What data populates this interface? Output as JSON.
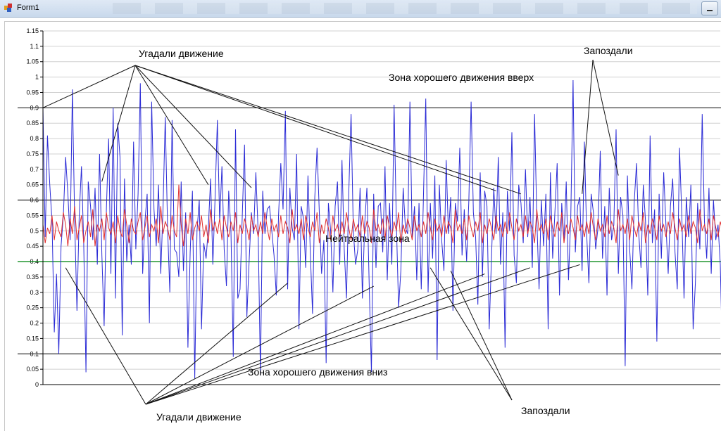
{
  "window": {
    "title": "Form1"
  },
  "colors": {
    "series_blue": "#2b2bd6",
    "series_red": "#e03030",
    "green_line": "#0a8a1a",
    "ref_line": "#3a3a3a",
    "grid": "#d0d0d0"
  },
  "chart_data": {
    "type": "line",
    "title": "",
    "xlabel": "",
    "ylabel": "",
    "ylim": [
      0,
      1.15
    ],
    "y_ticks": [
      "1.15",
      "1.1",
      "1.05",
      "1",
      "0.95",
      "0.9",
      "0.85",
      "0.8",
      "0.75",
      "0.7",
      "0.65",
      "0.6",
      "0.55",
      "0.5",
      "0.45",
      "0.4",
      "0.35",
      "0.3",
      "0.25",
      "0.2",
      "0.15",
      "0.1",
      "0.05",
      "0"
    ],
    "x_ticks_visible": false,
    "grid": true,
    "legend": "none",
    "x_count": 300,
    "series": [
      {
        "color": "#2b2bd6",
        "values": [
          0.9,
          0.48,
          0.81,
          0.65,
          0.53,
          0.17,
          0.36,
          0.1,
          0.45,
          0.55,
          0.74,
          0.62,
          0.47,
          0.96,
          0.54,
          0.24,
          0.55,
          0.71,
          0.46,
          0.04,
          0.66,
          0.58,
          0.47,
          0.64,
          0.39,
          0.75,
          0.42,
          0.19,
          0.57,
          0.8,
          0.36,
          0.9,
          0.28,
          0.85,
          0.74,
          0.16,
          0.67,
          0.4,
          0.52,
          0.39,
          0.79,
          0.44,
          0.62,
          0.98,
          0.36,
          0.53,
          0.62,
          0.2,
          0.92,
          0.57,
          0.45,
          0.65,
          0.36,
          0.57,
          0.87,
          0.51,
          0.3,
          0.86,
          0.44,
          0.43,
          0.35,
          0.66,
          0.37,
          0.56,
          0.12,
          0.43,
          0.63,
          0.02,
          0.5,
          0.6,
          0.18,
          0.46,
          0.41,
          0.51,
          0.67,
          0.39,
          0.61,
          0.86,
          0.53,
          0.71,
          0.44,
          0.32,
          0.63,
          0.5,
          0.09,
          0.83,
          0.28,
          0.31,
          0.55,
          0.78,
          0.22,
          0.4,
          0.56,
          0.49,
          0.69,
          0.49,
          0.03,
          0.63,
          0.49,
          0.57,
          0.58,
          0.5,
          0.42,
          0.29,
          0.55,
          0.72,
          0.57,
          0.89,
          0.31,
          0.64,
          0.51,
          0.47,
          0.75,
          0.18,
          0.58,
          0.54,
          0.38,
          0.68,
          0.43,
          0.23,
          0.61,
          0.77,
          0.56,
          0.36,
          0.47,
          0.07,
          0.59,
          0.5,
          0.3,
          0.58,
          0.66,
          0.39,
          0.73,
          0.44,
          0.28,
          0.62,
          0.88,
          0.5,
          0.39,
          0.44,
          0.64,
          0.28,
          0.52,
          0.64,
          0.33,
          0.04,
          0.62,
          0.38,
          0.58,
          0.59,
          0.43,
          0.71,
          0.34,
          0.59,
          0.39,
          0.91,
          0.53,
          0.25,
          0.37,
          0.64,
          0.51,
          0.49,
          0.92,
          0.48,
          0.58,
          0.34,
          0.59,
          0.31,
          0.62,
          0.93,
          0.3,
          0.59,
          0.41,
          0.68,
          0.08,
          0.65,
          0.47,
          0.37,
          0.73,
          0.49,
          0.61,
          0.24,
          0.59,
          0.53,
          0.77,
          0.42,
          0.57,
          0.4,
          0.6,
          0.92,
          0.56,
          0.48,
          0.26,
          0.69,
          0.35,
          0.63,
          0.58,
          0.18,
          0.41,
          0.64,
          0.49,
          0.74,
          0.39,
          0.56,
          0.12,
          0.63,
          0.5,
          0.82,
          0.42,
          0.33,
          0.65,
          0.59,
          0.46,
          0.7,
          0.48,
          0.61,
          0.38,
          0.88,
          0.54,
          0.31,
          0.6,
          0.45,
          0.62,
          0.18,
          0.69,
          0.41,
          0.56,
          0.72,
          0.29,
          0.59,
          0.47,
          0.66,
          0.34,
          0.55,
          0.99,
          0.43,
          0.58,
          0.61,
          0.37,
          0.79,
          0.49,
          0.33,
          0.62,
          0.56,
          0.44,
          0.51,
          0.76,
          0.41,
          0.58,
          0.29,
          0.64,
          0.47,
          0.52,
          0.83,
          0.36,
          0.61,
          0.55,
          0.06,
          0.68,
          0.44,
          0.31,
          0.59,
          0.72,
          0.49,
          0.38,
          0.65,
          0.53,
          0.29,
          0.81,
          0.46,
          0.57,
          0.14,
          0.62,
          0.41,
          0.69,
          0.52,
          0.36,
          0.58,
          0.67,
          0.43,
          0.31,
          0.77,
          0.55,
          0.28,
          0.61,
          0.48,
          0.65,
          0.18,
          0.33,
          0.59,
          0.44,
          0.88,
          0.53,
          0.41,
          0.64,
          0.36,
          0.6,
          0.47,
          0.52,
          0.39,
          0.07,
          0.58,
          0.1,
          0.45
        ]
      },
      {
        "color": "#e03030",
        "values": [
          0.52,
          0.46,
          0.51,
          0.49,
          0.55,
          0.47,
          0.53,
          0.5,
          0.48,
          0.56,
          0.52,
          0.45,
          0.54,
          0.49,
          0.58,
          0.47,
          0.51,
          0.55,
          0.46,
          0.5,
          0.53,
          0.48,
          0.57,
          0.45,
          0.52,
          0.5,
          0.54,
          0.47,
          0.56,
          0.51,
          0.49,
          0.53,
          0.46,
          0.55,
          0.5,
          0.48,
          0.57,
          0.52,
          0.46,
          0.54,
          0.5,
          0.49,
          0.53,
          0.56,
          0.47,
          0.51,
          0.55,
          0.48,
          0.52,
          0.5,
          0.54,
          0.46,
          0.58,
          0.49,
          0.53,
          0.51,
          0.47,
          0.55,
          0.5,
          0.48,
          0.65,
          0.52,
          0.45,
          0.54,
          0.49,
          0.56,
          0.47,
          0.51,
          0.53,
          0.5,
          0.55,
          0.48,
          0.52,
          0.46,
          0.57,
          0.5,
          0.53,
          0.49,
          0.54,
          0.47,
          0.55,
          0.51,
          0.48,
          0.53,
          0.5,
          0.56,
          0.46,
          0.52,
          0.49,
          0.54,
          0.51,
          0.47,
          0.55,
          0.5,
          0.52,
          0.48,
          0.53,
          0.49,
          0.56,
          0.51,
          0.47,
          0.54,
          0.5,
          0.52,
          0.48,
          0.55,
          0.49,
          0.53,
          0.51,
          0.46,
          0.57,
          0.5,
          0.52,
          0.49,
          0.54,
          0.47,
          0.55,
          0.51,
          0.48,
          0.53,
          0.5,
          0.56,
          0.46,
          0.52,
          0.49,
          0.54,
          0.51,
          0.47,
          0.55,
          0.5,
          0.52,
          0.48,
          0.53,
          0.49,
          0.56,
          0.51,
          0.47,
          0.54,
          0.5,
          0.52,
          0.48,
          0.55,
          0.49,
          0.53,
          0.51,
          0.46,
          0.57,
          0.5,
          0.52,
          0.49,
          0.54,
          0.47,
          0.55,
          0.51,
          0.48,
          0.53,
          0.5,
          0.56,
          0.46,
          0.52,
          0.49,
          0.54,
          0.51,
          0.47,
          0.55,
          0.5,
          0.52,
          0.48,
          0.53,
          0.49,
          0.56,
          0.51,
          0.47,
          0.54,
          0.5,
          0.52,
          0.48,
          0.55,
          0.49,
          0.53,
          0.51,
          0.46,
          0.57,
          0.5,
          0.52,
          0.49,
          0.54,
          0.47,
          0.55,
          0.51,
          0.48,
          0.53,
          0.5,
          0.56,
          0.46,
          0.52,
          0.49,
          0.54,
          0.51,
          0.47,
          0.55,
          0.5,
          0.52,
          0.48,
          0.53,
          0.49,
          0.56,
          0.51,
          0.47,
          0.54,
          0.5,
          0.52,
          0.48,
          0.55,
          0.49,
          0.53,
          0.51,
          0.46,
          0.57,
          0.5,
          0.52,
          0.49,
          0.54,
          0.47,
          0.55,
          0.51,
          0.48,
          0.53,
          0.5,
          0.56,
          0.46,
          0.52,
          0.49,
          0.54,
          0.51,
          0.47,
          0.55,
          0.5,
          0.52,
          0.48,
          0.53,
          0.49,
          0.56,
          0.51,
          0.47,
          0.54,
          0.5,
          0.52,
          0.48,
          0.55,
          0.49,
          0.53,
          0.51,
          0.46,
          0.57,
          0.5,
          0.52,
          0.49,
          0.54,
          0.47,
          0.55,
          0.51,
          0.48,
          0.53,
          0.5,
          0.56,
          0.46,
          0.52,
          0.49,
          0.54,
          0.51,
          0.47,
          0.55,
          0.5,
          0.52,
          0.48,
          0.53,
          0.49,
          0.56,
          0.51,
          0.47,
          0.54,
          0.5,
          0.52,
          0.48,
          0.55,
          0.49,
          0.53,
          0.51,
          0.46,
          0.57,
          0.5,
          0.52,
          0.49,
          0.54,
          0.47,
          0.55,
          0.51,
          0.48,
          0.53,
          0.5,
          0.56,
          0.46,
          0.52
        ]
      }
    ],
    "reference_lines": [
      {
        "y": 0.9,
        "color": "#3a3a3a"
      },
      {
        "y": 0.6,
        "color": "#3a3a3a"
      },
      {
        "y": 0.4,
        "color": "#0a8a1a"
      },
      {
        "y": 0.1,
        "color": "#3a3a3a"
      }
    ],
    "annotations": [
      {
        "id": "ann-guessed-top",
        "text": "Угадали движение"
      },
      {
        "id": "ann-late-top",
        "text": "Запоздали"
      },
      {
        "id": "ann-zone-up",
        "text": "Зона хорошего движения вверх"
      },
      {
        "id": "ann-neutral",
        "text": "Нейтральная зона"
      },
      {
        "id": "ann-zone-down",
        "text": "Зона хорошего движения вниз"
      },
      {
        "id": "ann-guessed-bottom",
        "text": "Угадали движение"
      },
      {
        "id": "ann-late-bottom",
        "text": "Запоздали"
      }
    ]
  }
}
